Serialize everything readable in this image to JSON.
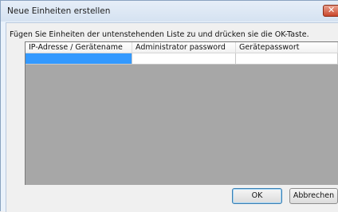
{
  "window": {
    "title": "Neue Einheiten erstellen"
  },
  "dialog": {
    "instruction": "Fügen Sie Einheiten der untenstehenden Liste zu und drücken sie die OK-Taste."
  },
  "table": {
    "columns": [
      "IP-Adresse / Gerätename",
      "Administrator password",
      "Gerätepasswort"
    ],
    "rows": [
      [
        "",
        "",
        ""
      ]
    ]
  },
  "buttons": {
    "ok": "OK",
    "cancel": "Abbrechen"
  },
  "colors": {
    "selection": "#3399ff",
    "grid_background": "#a7a7a7",
    "close_button": "#c9462c"
  },
  "icons": {
    "close": "close-icon"
  }
}
